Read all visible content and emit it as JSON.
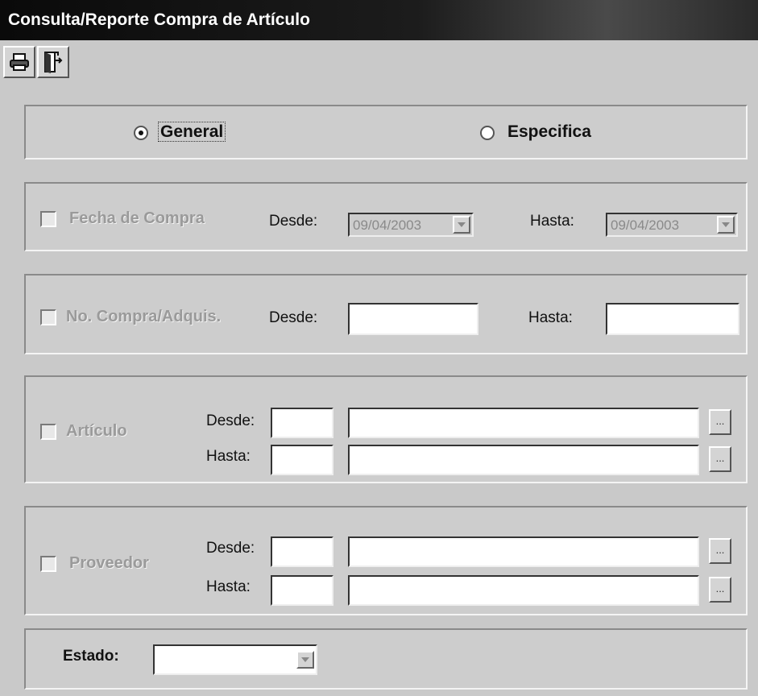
{
  "window": {
    "title": "Consulta/Reporte Compra de Artículo"
  },
  "toolbar": {
    "buttons": [
      {
        "icon": "printer-icon"
      },
      {
        "icon": "exit-door-icon"
      }
    ]
  },
  "mode": {
    "general_label": "General",
    "especifica_label": "Especifica",
    "selected": "General"
  },
  "fecha": {
    "label": "Fecha de Compra",
    "desde_label": "Desde:",
    "desde_value": "09/04/2003",
    "hasta_label": "Hasta:",
    "hasta_value": "09/04/2003"
  },
  "compra": {
    "label": "No. Compra/Adquis.",
    "desde_label": "Desde:",
    "hasta_label": "Hasta:"
  },
  "articulo": {
    "label": "Artículo",
    "desde_label": "Desde:",
    "hasta_label": "Hasta:",
    "browse_label": "..."
  },
  "proveedor": {
    "label": "Proveedor",
    "desde_label": "Desde:",
    "hasta_label": "Hasta:",
    "browse_label": "..."
  },
  "estado": {
    "label": "Estado:",
    "value": ""
  }
}
